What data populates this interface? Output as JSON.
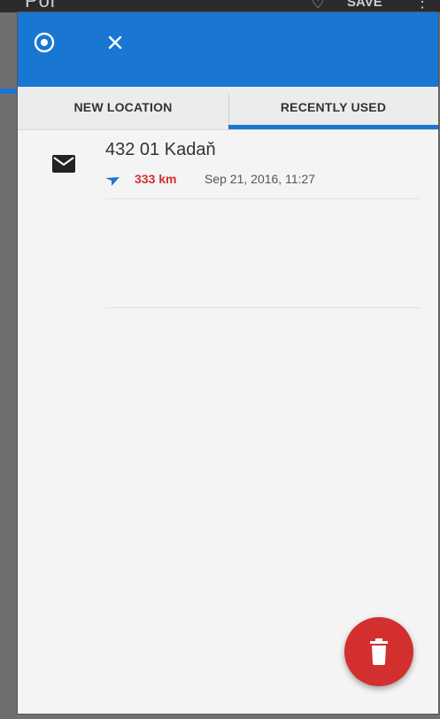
{
  "background": {
    "title_partial": "Poi",
    "save_label": "SAVE",
    "heart_icon": "heart-outline-icon",
    "more_icon": "more-vert-icon"
  },
  "header": {
    "target_icon": "my-location-icon",
    "close_icon": "close-icon",
    "color": "#1976d2"
  },
  "tabs": [
    {
      "label": "NEW LOCATION",
      "active": false
    },
    {
      "label": "RECENTLY USED",
      "active": true
    }
  ],
  "list": {
    "items": [
      {
        "icon": "mail-icon",
        "title": "432 01 Kadaň",
        "distance": "333 km",
        "datetime": "Sep 21, 2016, 11:27",
        "direction_icon": "direction-arrow-icon"
      }
    ]
  },
  "fab": {
    "icon": "trash-icon",
    "color": "#d32f2f"
  }
}
